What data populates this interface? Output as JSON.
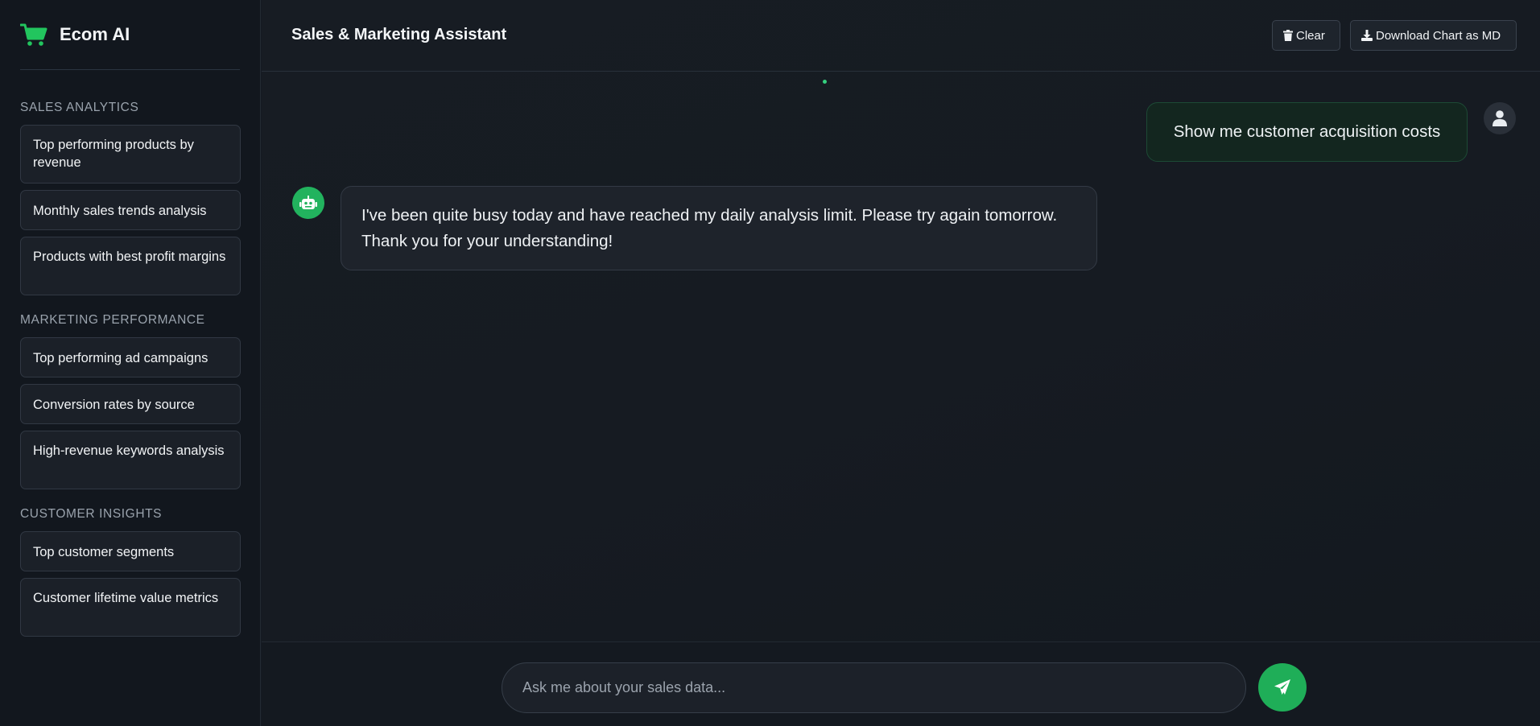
{
  "sidebar": {
    "brand_name": "Ecom AI",
    "sections": [
      {
        "title": "SALES ANALYTICS",
        "items": [
          "Top performing products by revenue",
          "Monthly sales trends analysis",
          "Products with best profit margins"
        ]
      },
      {
        "title": "MARKETING PERFORMANCE",
        "items": [
          "Top performing ad campaigns",
          "Conversion rates by source",
          "High-revenue keywords analysis"
        ]
      },
      {
        "title": "CUSTOMER INSIGHTS",
        "items": [
          "Top customer segments",
          "Customer lifetime value metrics"
        ]
      }
    ]
  },
  "header": {
    "title": "Sales & Marketing Assistant",
    "clear_label": "Clear",
    "download_label": "Download Chart as MD"
  },
  "chat": {
    "messages": [
      {
        "role": "user",
        "text": "Show me customer acquisition costs"
      },
      {
        "role": "assistant",
        "text": "I've been quite busy today and have reached my daily analysis limit. Please try again tomorrow. Thank you for your understanding!"
      }
    ]
  },
  "input": {
    "placeholder": "Ask me about your sales data...",
    "value": ""
  },
  "colors": {
    "accent": "#22b35e",
    "background": "#151a22",
    "user_bubble": "#13261f"
  },
  "icons": {
    "brand": "shopping-cart-icon",
    "clear": "trash-icon",
    "download": "download-icon",
    "user": "user-icon",
    "bot": "robot-icon",
    "send": "paper-plane-icon"
  }
}
